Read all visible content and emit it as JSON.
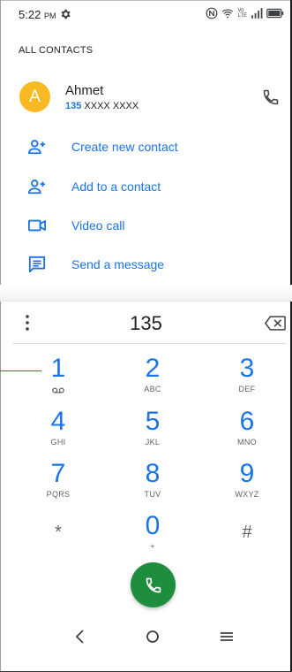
{
  "status_bar": {
    "time": "5:22",
    "ampm": "PM",
    "network": "LTE",
    "volte": "Vo"
  },
  "section_label": "ALL CONTACTS",
  "contact": {
    "initial": "A",
    "name": "Ahmet",
    "number_match": "135",
    "number_rest": " XXXX XXXX",
    "avatar_color": "#f9b924"
  },
  "actions": [
    {
      "label": "Create new contact",
      "icon": "person-add-icon"
    },
    {
      "label": "Add to a contact",
      "icon": "person-add-icon"
    },
    {
      "label": "Video call",
      "icon": "video-camera-icon"
    },
    {
      "label": "Send a message",
      "icon": "message-icon"
    }
  ],
  "dialer": {
    "digits": "135"
  },
  "keypad": [
    {
      "num": "1",
      "sub": ""
    },
    {
      "num": "2",
      "sub": "ABC"
    },
    {
      "num": "3",
      "sub": "DEF"
    },
    {
      "num": "4",
      "sub": "GHI"
    },
    {
      "num": "5",
      "sub": "JKL"
    },
    {
      "num": "6",
      "sub": "MNO"
    },
    {
      "num": "7",
      "sub": "PQRS"
    },
    {
      "num": "8",
      "sub": "TUV"
    },
    {
      "num": "9",
      "sub": "WXYZ"
    },
    {
      "num": "*",
      "sub": ""
    },
    {
      "num": "0",
      "sub": "+"
    },
    {
      "num": "#",
      "sub": ""
    }
  ],
  "colors": {
    "accent": "#1a73e8",
    "call_button": "#1e8e3e"
  }
}
